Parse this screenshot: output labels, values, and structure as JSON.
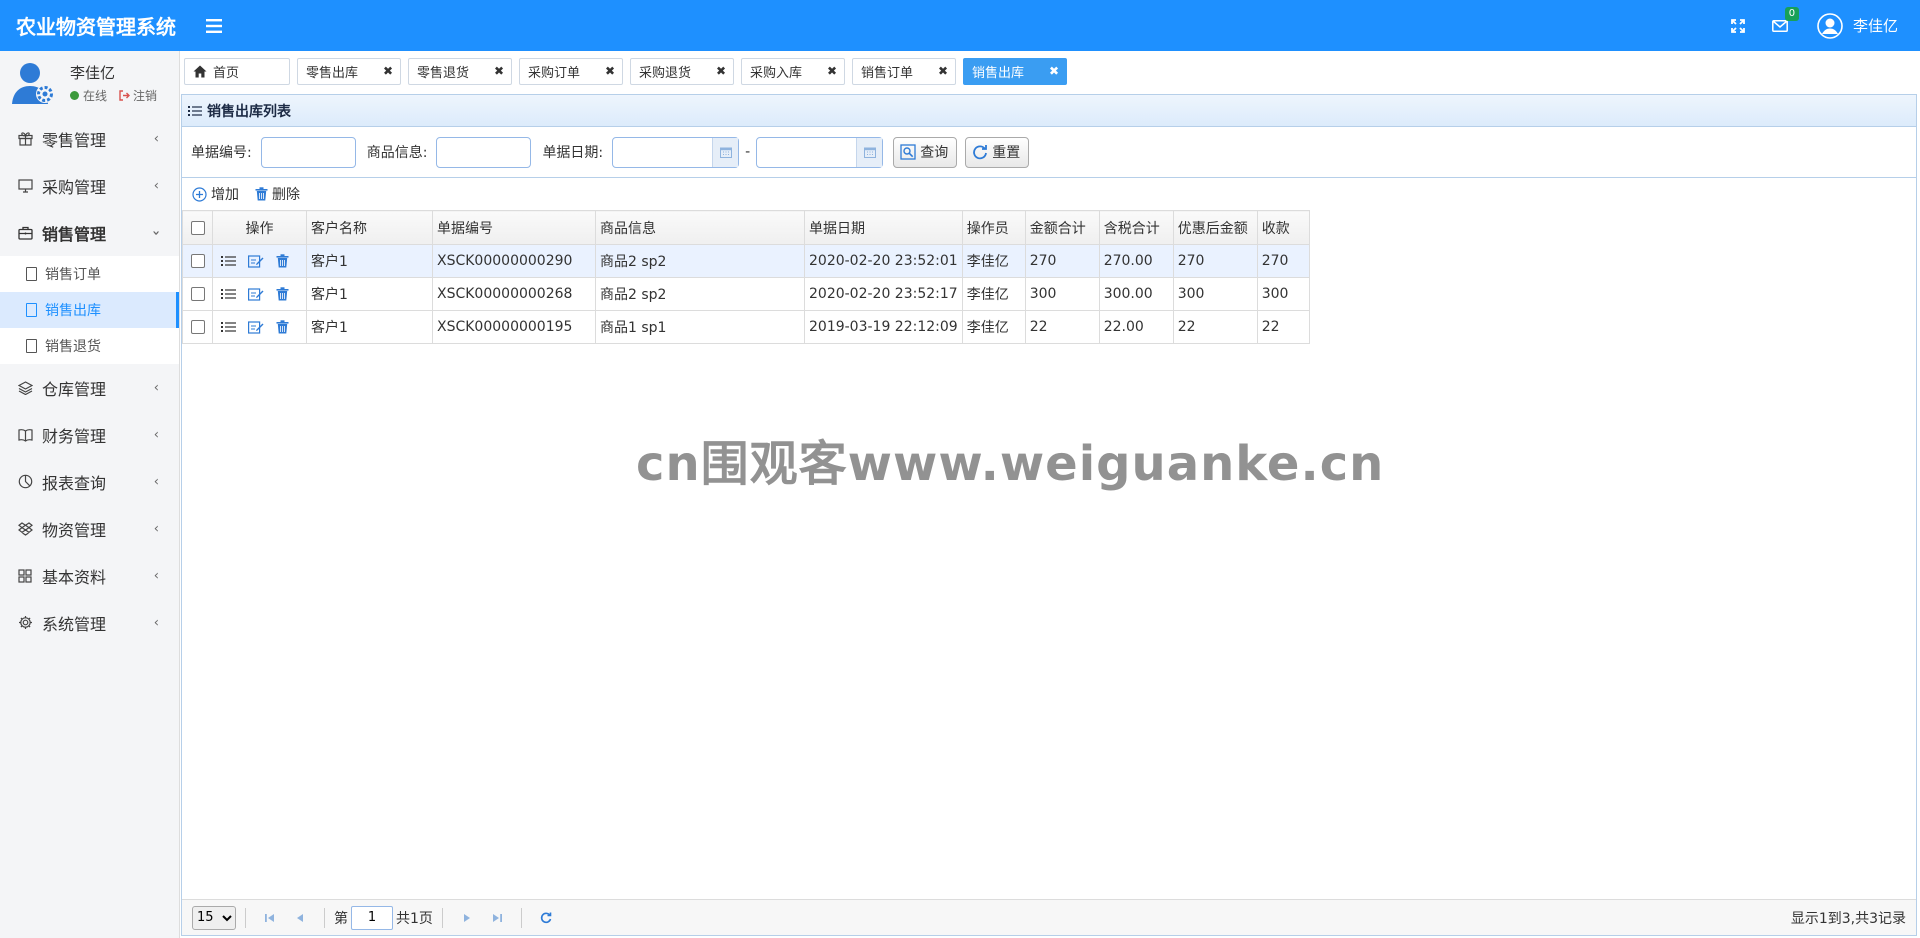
{
  "header": {
    "title": "农业物资管理系统",
    "notification_count": "0",
    "username": "李佳亿"
  },
  "sidebar": {
    "user": {
      "name": "李佳亿",
      "status": "在线",
      "logout": "注销"
    },
    "items": [
      {
        "label": "零售管理",
        "icon": "gift-icon"
      },
      {
        "label": "采购管理",
        "icon": "monitor-icon"
      },
      {
        "label": "销售管理",
        "icon": "briefcase-icon",
        "open": true,
        "children": [
          {
            "label": "销售订单"
          },
          {
            "label": "销售出库",
            "active": true
          },
          {
            "label": "销售退货"
          }
        ]
      },
      {
        "label": "仓库管理",
        "icon": "layers-icon"
      },
      {
        "label": "财务管理",
        "icon": "book-icon"
      },
      {
        "label": "报表查询",
        "icon": "pie-chart-icon"
      },
      {
        "label": "物资管理",
        "icon": "dropbox-icon"
      },
      {
        "label": "基本资料",
        "icon": "grid-icon"
      },
      {
        "label": "系统管理",
        "icon": "gear-icon"
      }
    ]
  },
  "tabs": [
    {
      "label": "首页"
    },
    {
      "label": "零售出库"
    },
    {
      "label": "零售退货"
    },
    {
      "label": "采购订单"
    },
    {
      "label": "采购退货"
    },
    {
      "label": "采购入库"
    },
    {
      "label": "销售订单"
    },
    {
      "label": "销售出库",
      "active": true
    }
  ],
  "panel": {
    "title": "销售出库列表",
    "search": {
      "bill_no_label": "单据编号:",
      "goods_label": "商品信息:",
      "date_label": "单据日期:",
      "date_sep": "-",
      "query_label": "查询",
      "reset_label": "重置"
    },
    "toolbar": {
      "add_label": "增加",
      "delete_label": "删除"
    },
    "columns": [
      "操作",
      "客户名称",
      "单据编号",
      "商品信息",
      "单据日期",
      "操作员",
      "金额合计",
      "含税合计",
      "优惠后金额",
      "收款"
    ],
    "rows": [
      {
        "customer": "客户1",
        "bill_no": "XSCK00000000290",
        "goods": "商品2 sp2",
        "date": "2020-02-20 23:52:01",
        "operator": "李佳亿",
        "amount": "270",
        "tax_total": "270.00",
        "discounted": "270",
        "received": "270"
      },
      {
        "customer": "客户1",
        "bill_no": "XSCK00000000268",
        "goods": "商品2 sp2",
        "date": "2020-02-20 23:52:17",
        "operator": "李佳亿",
        "amount": "300",
        "tax_total": "300.00",
        "discounted": "300",
        "received": "300"
      },
      {
        "customer": "客户1",
        "bill_no": "XSCK00000000195",
        "goods": "商品1 sp1",
        "date": "2019-03-19 22:12:09",
        "operator": "李佳亿",
        "amount": "22",
        "tax_total": "22.00",
        "discounted": "22",
        "received": "22"
      }
    ],
    "pager": {
      "page_size": "15",
      "page_prefix": "第",
      "page_value": "1",
      "page_suffix": "共1页",
      "summary": "显示1到3,共3记录"
    }
  },
  "watermark": "cn围观客www.weiguanke.cn",
  "colors": {
    "primary": "#1e90ff",
    "active_tab": "#3a9df2",
    "delete_icon": "#1e90ff"
  }
}
